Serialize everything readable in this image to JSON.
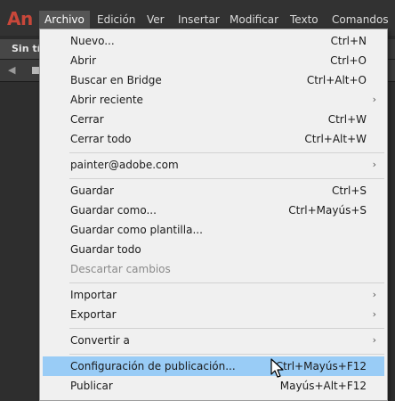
{
  "app": {
    "logo": "An",
    "brand_color": "#c8473a"
  },
  "menubar": {
    "items": [
      {
        "label": "Archivo",
        "active": true
      },
      {
        "label": "Edición"
      },
      {
        "label": "Ver"
      },
      {
        "label": "Insertar"
      },
      {
        "label": "Modificar"
      },
      {
        "label": "Texto"
      },
      {
        "label": "Comandos"
      }
    ]
  },
  "document": {
    "tab_label": "Sin títu"
  },
  "archivo_menu": {
    "highlight_color": "#99ccf6",
    "items": [
      {
        "label": "Nuevo...",
        "shortcut": "Ctrl+N"
      },
      {
        "label": "Abrir",
        "shortcut": "Ctrl+O"
      },
      {
        "label": "Buscar en Bridge",
        "shortcut": "Ctrl+Alt+O"
      },
      {
        "label": "Abrir reciente",
        "submenu": true
      },
      {
        "label": "Cerrar",
        "shortcut": "Ctrl+W"
      },
      {
        "label": "Cerrar todo",
        "shortcut": "Ctrl+Alt+W"
      },
      {
        "label": "painter@adobe.com",
        "submenu": true
      },
      {
        "label": "Guardar",
        "shortcut": "Ctrl+S"
      },
      {
        "label": "Guardar como...",
        "shortcut": "Ctrl+Mayús+S"
      },
      {
        "label": "Guardar como plantilla..."
      },
      {
        "label": "Guardar todo"
      },
      {
        "label": "Descartar cambios",
        "disabled": true
      },
      {
        "label": "Importar",
        "submenu": true
      },
      {
        "label": "Exportar",
        "submenu": true
      },
      {
        "label": "Convertir a",
        "submenu": true
      },
      {
        "label": "Configuración de publicación...",
        "shortcut": "Ctrl+Mayús+F12",
        "highlighted": true
      },
      {
        "label": "Publicar",
        "shortcut": "Mayús+Alt+F12"
      }
    ],
    "submenu_glyph": "›"
  },
  "icons": {
    "back": "◀"
  }
}
